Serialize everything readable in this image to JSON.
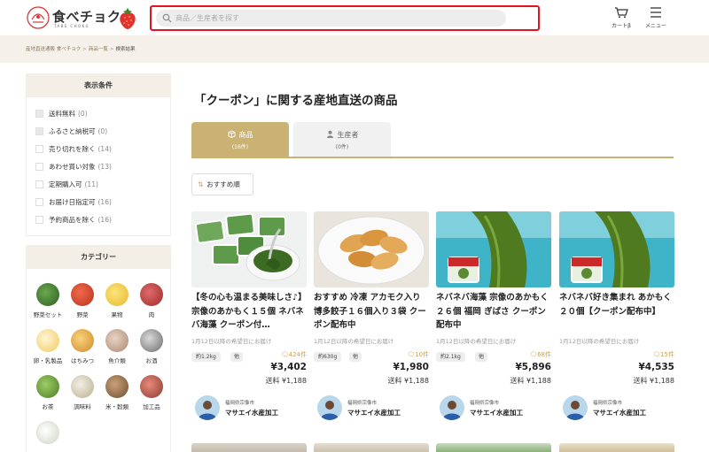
{
  "header": {
    "logo_text": "食べチョク",
    "logo_sub": "TABE CHOKU",
    "search_placeholder": "商品／生産者を探す",
    "cart_label": "カートβ",
    "menu_label": "メニュー"
  },
  "breadcrumb": [
    "産地直送通販 食べチョク",
    "商品一覧",
    "検索結果"
  ],
  "sidebar": {
    "filters_title": "表示条件",
    "filters": [
      {
        "label": "送料無料",
        "count": "(0)"
      },
      {
        "label": "ふるさと納税可",
        "count": "(0)"
      },
      {
        "label": "売り切れを除く",
        "count": "(14)"
      },
      {
        "label": "あわせ買い対象",
        "count": "(13)"
      },
      {
        "label": "定期購入可",
        "count": "(11)"
      },
      {
        "label": "お届け日指定可",
        "count": "(16)"
      },
      {
        "label": "予約商品を除く",
        "count": "(16)"
      }
    ],
    "categories_title": "カテゴリー",
    "categories": [
      "野菜セット",
      "野菜",
      "果物",
      "肉",
      "卵・乳製品",
      "はちみつ",
      "魚介類",
      "お酒",
      "お茶",
      "調味料",
      "米・穀類",
      "加工品"
    ]
  },
  "main": {
    "title": "「クーポン」に関する産地直送の商品",
    "tabs": [
      {
        "label": "商品",
        "count": "(16件)"
      },
      {
        "label": "生産者",
        "count": "(0件)"
      }
    ],
    "sort_label": "おすすめ順",
    "products": [
      {
        "name": "【冬の心も温まる美味しさ♪】宗像のあかもく１５個 ネバネバ海藻 クーポン付…",
        "ship": "1月12日以降の希望日にお届け",
        "weight": "約1.2kg",
        "unit": "他",
        "reviews": "424件",
        "price": "¥3,402",
        "postage": "送料 ¥1,188",
        "pref": "福岡県宗像市",
        "shop": "マサエイ水産加工"
      },
      {
        "name": "おすすめ 冷凍 アカモク入り博多餃子１６個入り３袋 クーポン配布中",
        "ship": "1月12日以降の希望日にお届け",
        "weight": "約630g",
        "unit": "他",
        "reviews": "10件",
        "price": "¥1,980",
        "postage": "送料 ¥1,188",
        "pref": "福岡県宗像市",
        "shop": "マサエイ水産加工"
      },
      {
        "name": "ネバネバ海藻 宗像のあかもく２６個 福岡 ぎばさ クーポン配布中",
        "ship": "1月12日以降の希望日にお届け",
        "weight": "約2.1kg",
        "unit": "他",
        "reviews": "68件",
        "price": "¥5,896",
        "postage": "送料 ¥1,188",
        "pref": "福岡県宗像市",
        "shop": "マサエイ水産加工"
      },
      {
        "name": "ネバネバ好き集まれ あかもく２０個【クーポン配布中】",
        "ship": "1月12日以降の希望日にお届け",
        "weight": "",
        "unit": "",
        "reviews": "15件",
        "price": "¥4,535",
        "postage": "送料 ¥1,188",
        "pref": "福岡県宗像市",
        "shop": "マサエイ水産加工"
      }
    ]
  },
  "colors": {
    "accent_gold": "#c9b273",
    "highlight_red": "#e5131d",
    "review_gold": "#c9a24a"
  }
}
